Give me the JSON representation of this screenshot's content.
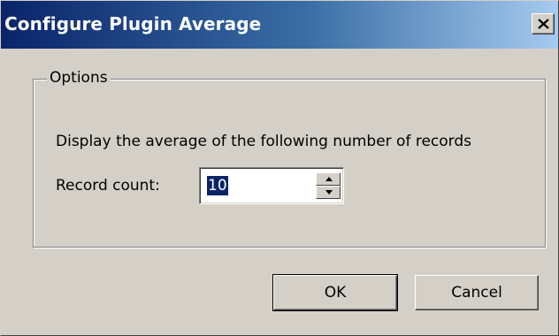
{
  "window": {
    "title": "Configure Plugin Average",
    "close_glyph": "✕"
  },
  "options_group": {
    "legend": "Options",
    "description": "Display the average of the following number of records",
    "record_count_label": "Record count:",
    "record_count_value": "10"
  },
  "buttons": {
    "ok_label": "OK",
    "cancel_label": "Cancel"
  },
  "icons": {
    "close": "close-icon",
    "spin_up": "spin-up-arrow-icon",
    "spin_down": "spin-down-arrow-icon"
  },
  "colors": {
    "titlebar_start": "#0a246a",
    "titlebar_end": "#a6caf0",
    "face": "#d4d0c8",
    "selection": "#0a246a"
  }
}
